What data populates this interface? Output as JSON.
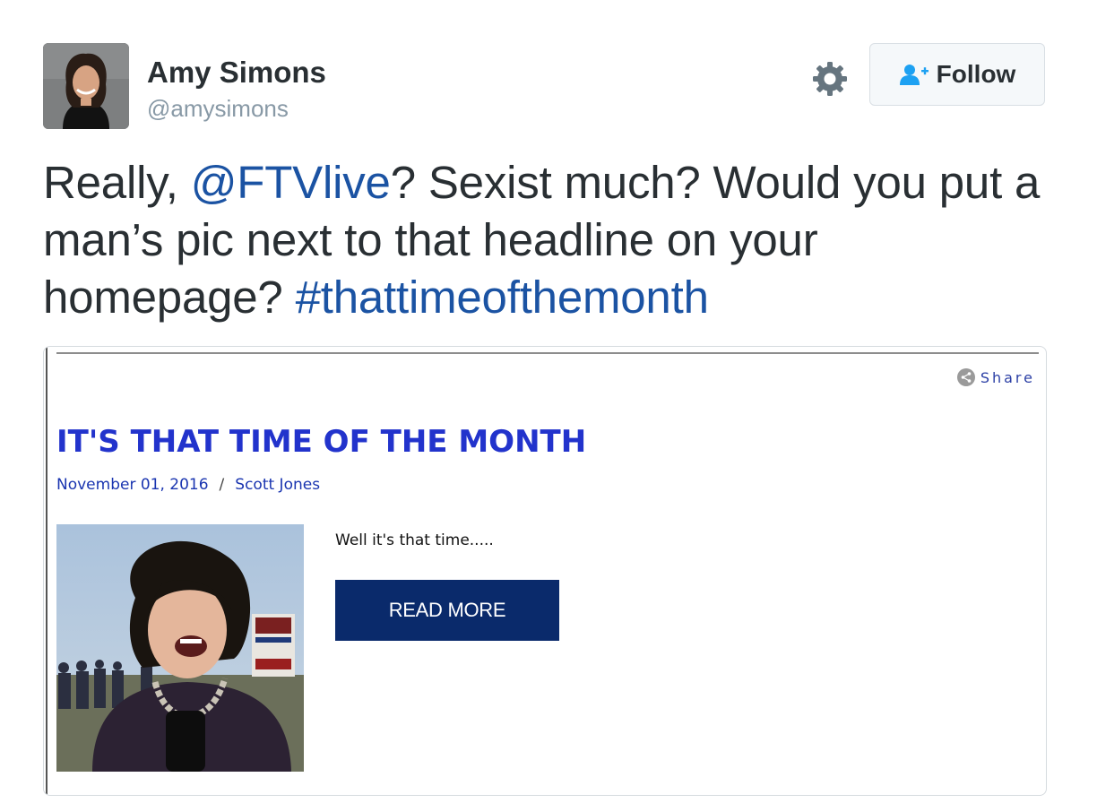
{
  "author": {
    "name": "Amy Simons",
    "handle": "@amysimons"
  },
  "actions": {
    "settings_icon": "gear-icon",
    "follow_label": "Follow",
    "follow_icon": "add-user-icon"
  },
  "tweet": {
    "text_part1": "Really, ",
    "mention": "@FTVlive",
    "text_part2": "? Sexist much? Would you put a man’s pic next to that headline on your homepage? ",
    "hashtag": "#thattimeofthemonth"
  },
  "card": {
    "share_label": "Share",
    "title": "IT'S THAT TIME OF THE MONTH",
    "date": "November 01, 2016",
    "separator": "/",
    "author": "Scott Jones",
    "excerpt": "Well it's that time.....",
    "button_label": "READ MORE"
  },
  "colors": {
    "link": "#1b53a3",
    "card_title": "#2233cc",
    "button_bg": "#0a2a6b"
  }
}
